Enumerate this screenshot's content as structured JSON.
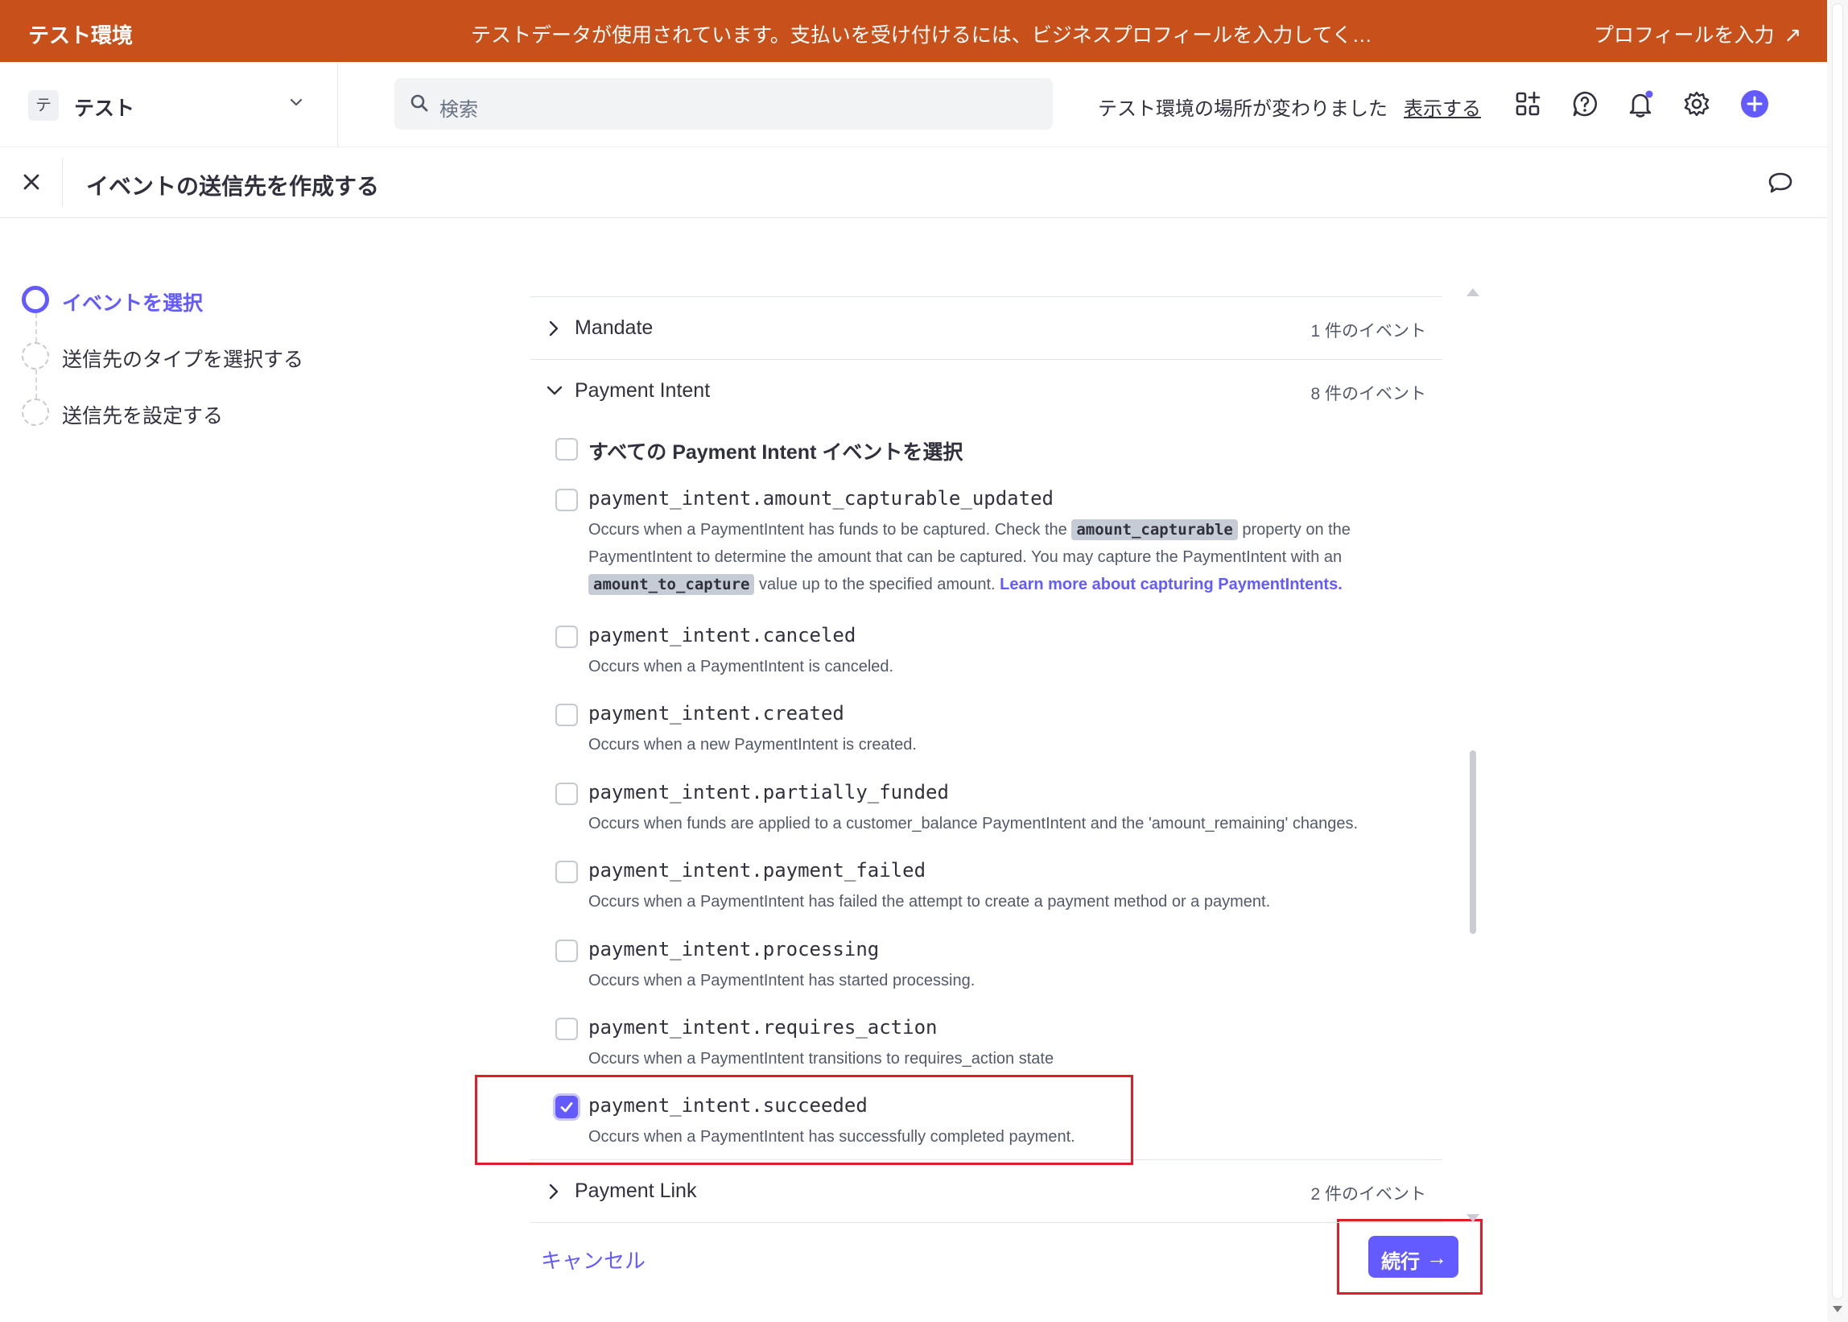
{
  "banner": {
    "env_label": "テスト環境",
    "message": "テストデータが使用されています。支払いを受け付けるには、ビジネスプロフィールを入力してく…",
    "profile_link": "プロフィールを入力",
    "background": "#c8501a"
  },
  "header": {
    "account_badge": "テ",
    "account_name": "テスト",
    "search_placeholder": "検索",
    "env_note": "テスト環境の場所が変わりました",
    "env_link": "表示する",
    "icons": [
      "apps-icon",
      "help-icon",
      "bell-icon",
      "gear-icon",
      "plus-icon"
    ]
  },
  "subheader": {
    "title": "イベントの送信先を作成する"
  },
  "steps": [
    {
      "label": "イベントを選択",
      "active": true
    },
    {
      "label": "送信先のタイプを選択する",
      "active": false
    },
    {
      "label": "送信先を設定する",
      "active": false
    }
  ],
  "groups": {
    "mandate": {
      "name": "Mandate",
      "count": "1 件のイベント",
      "expanded": false
    },
    "payment_intent": {
      "name": "Payment Intent",
      "count": "8 件のイベント",
      "expanded": true
    },
    "payment_link": {
      "name": "Payment Link",
      "count": "2 件のイベント",
      "expanded": false
    }
  },
  "select_all": "すべての Payment Intent イベントを選択",
  "events": [
    {
      "name": "payment_intent.amount_capturable_updated",
      "desc_1": "Occurs when a PaymentIntent has funds to be captured. Check the",
      "code_1": "amount_capturable",
      "desc_2": "property on the PaymentIntent to determine the amount that can be captured. You may capture the PaymentIntent with an",
      "code_2": "amount_to_capture",
      "desc_3": "value up to the specified amount.",
      "link": "Learn more about capturing PaymentIntents.",
      "checked": false
    },
    {
      "name": "payment_intent.canceled",
      "desc": "Occurs when a PaymentIntent is canceled.",
      "checked": false
    },
    {
      "name": "payment_intent.created",
      "desc": "Occurs when a new PaymentIntent is created.",
      "checked": false
    },
    {
      "name": "payment_intent.partially_funded",
      "desc": "Occurs when funds are applied to a customer_balance PaymentIntent and the 'amount_remaining' changes.",
      "checked": false
    },
    {
      "name": "payment_intent.payment_failed",
      "desc": "Occurs when a PaymentIntent has failed the attempt to create a payment method or a payment.",
      "checked": false
    },
    {
      "name": "payment_intent.processing",
      "desc": "Occurs when a PaymentIntent has started processing.",
      "checked": false
    },
    {
      "name": "payment_intent.requires_action",
      "desc": "Occurs when a PaymentIntent transitions to requires_action state",
      "checked": false
    },
    {
      "name": "payment_intent.succeeded",
      "desc": "Occurs when a PaymentIntent has successfully completed payment.",
      "checked": true
    }
  ],
  "footer": {
    "cancel": "キャンセル",
    "continue": "続行",
    "continue_arrow": "→"
  },
  "colors": {
    "accent": "#635bff",
    "highlight": "#e21d2b"
  }
}
